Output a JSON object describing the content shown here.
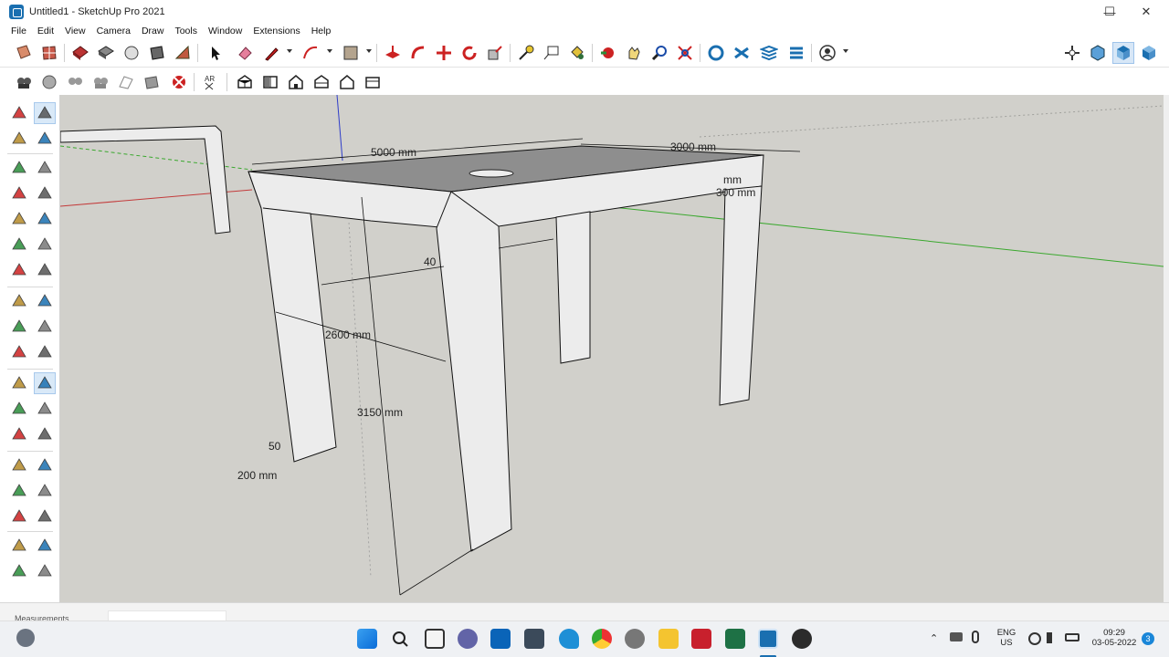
{
  "window": {
    "title": "Untitled1 - SketchUp Pro 2021",
    "controls": {
      "minimize": "—",
      "maximize": "☐",
      "close": "✕"
    }
  },
  "menu": [
    "File",
    "Edit",
    "View",
    "Camera",
    "Draw",
    "Tools",
    "Window",
    "Extensions",
    "Help"
  ],
  "toolbar_main": [
    "section-plane-icon",
    "section-fill-icon",
    "warehouse-icon",
    "extension-warehouse-icon",
    "component-icon",
    "materials-icon",
    "style-icon",
    "select-icon",
    "eraser-icon",
    "pencil-icon",
    "arc-icon",
    "rectangle-icon",
    "push-pull-icon",
    "follow-me-icon",
    "move-icon",
    "rotate-icon",
    "scale-icon",
    "tape-measure-icon",
    "text-icon",
    "paint-bucket-icon",
    "orbit-icon",
    "pan-icon",
    "zoom-icon",
    "zoom-extents-icon",
    "outliner-icon",
    "layers-icon",
    "scenes-icon",
    "components-panel-icon",
    "account-icon"
  ],
  "toolbar_right": [
    "views-icon",
    "iso-view-icon",
    "top-view-icon",
    "front-view-icon"
  ],
  "toolbar_secondary": [
    "camera-icon",
    "walk-icon",
    "look-around-icon",
    "position-camera-icon",
    "section-display-icon",
    "section-cut-icon",
    "dimension-style-icon",
    "iso-house-icon",
    "front-house-icon",
    "top-house-icon",
    "right-house-icon",
    "back-house-icon",
    "left-house-icon"
  ],
  "left_tools": [
    "select-tool-icon",
    "component-tool-icon",
    "paint-tool-icon",
    "eraser-tool-icon",
    "line-tool-icon",
    "freehand-tool-icon",
    "rectangle-tool-icon",
    "rotated-rectangle-tool-icon",
    "circle-tool-icon",
    "polygon-tool-icon",
    "arc-tool-icon",
    "two-point-arc-tool-icon",
    "three-point-arc-tool-icon",
    "pie-tool-icon",
    "move-tool-icon",
    "push-pull-tool-icon",
    "rotate-tool-icon",
    "follow-me-tool-icon",
    "scale-tool-icon",
    "offset-tool-icon",
    "tape-measure-tool-icon",
    "dimension-tool-icon",
    "protractor-tool-icon",
    "text-tool-icon",
    "axes-tool-icon",
    "3d-text-tool-icon",
    "orbit-tool-icon",
    "pan-tool-icon",
    "zoom-tool-icon",
    "zoom-window-tool-icon",
    "zoom-extents-tool-icon",
    "previous-view-tool-icon",
    "position-camera-tool-icon",
    "look-around-tool-icon",
    "walk-tool-icon",
    "section-plane-tool-icon"
  ],
  "dimensions": {
    "width_top": "5000 mm",
    "depth_top": "3000 mm",
    "edge_mm": "mm",
    "edge_300": "300 mm",
    "inner_40": "40",
    "inner_2600": "2600 mm",
    "height_3150": "3150 mm",
    "leg_50": "50",
    "leg_200": "200 mm"
  },
  "status": {
    "measurements_label": "Measurements",
    "measurements_value": ""
  },
  "taskbar": {
    "apps": [
      "windows-start-icon",
      "search-icon",
      "file-explorer-icon",
      "teams-icon",
      "outlook-icon",
      "calculator-icon",
      "pin-tool-icon",
      "chrome-icon",
      "settings-icon",
      "folder-icon",
      "autocad-icon",
      "excel-icon",
      "sketchup-icon",
      "obs-icon"
    ],
    "tray": {
      "lang_top": "ENG",
      "lang_bottom": "US",
      "time": "09:29",
      "date": "03-05-2022",
      "notification_count": "3"
    }
  },
  "colors": {
    "viewport": "#d1d0cb",
    "top_face": "#8e8e8e",
    "side_face": "#ececec",
    "edge": "#111111",
    "axis_red": "#c33b3b",
    "axis_green": "#3aa82e",
    "axis_blue": "#2e3cc9"
  }
}
